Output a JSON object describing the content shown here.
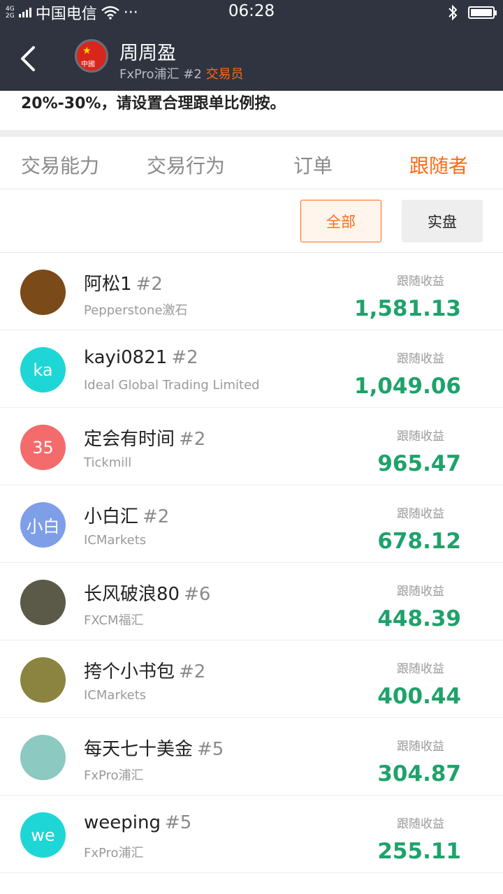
{
  "status_bar": {
    "network_top": "4G",
    "network_bottom": "2G",
    "carrier": "中国电信",
    "wifi_icon": "wifi-icon",
    "more": "···",
    "time": "06:28",
    "bluetooth_icon": "bluetooth-icon",
    "battery_icon": "battery-icon"
  },
  "header": {
    "back_icon": "back-arrow-icon",
    "flag_label": "中國",
    "trader_name": "周周盈",
    "broker_rank": "FxPro浦汇 #2",
    "role": "交易员"
  },
  "notice": "20%-30%，请设置合理跟单比例按。",
  "tabs": [
    "交易能力",
    "交易行为",
    "订单",
    "跟随者"
  ],
  "active_tab": "跟随者",
  "filters": {
    "all": "全部",
    "real": "实盘"
  },
  "profit_label": "跟随收益",
  "colors": {
    "accent": "#ff6a13",
    "profit": "#1ea26b",
    "header_bg": "#2f3440"
  },
  "followers": [
    {
      "name": "阿松1",
      "rank": "#2",
      "broker": "Pepperstone激石",
      "profit": "1,581.13",
      "avatar_text": "",
      "avatar_color": "#7a4a18"
    },
    {
      "name": "kayi0821",
      "rank": "#2",
      "broker": "Ideal Global Trading Limited",
      "profit": "1,049.06",
      "avatar_text": "ka",
      "avatar_color": "#1fd6d6"
    },
    {
      "name": "定会有时间",
      "rank": "#2",
      "broker": "Tickmill",
      "profit": "965.47",
      "avatar_text": "35",
      "avatar_color": "#f36b6b"
    },
    {
      "name": "小白汇",
      "rank": "#2",
      "broker": "ICMarkets",
      "profit": "678.12",
      "avatar_text": "小白",
      "avatar_color": "#7f9ee8"
    },
    {
      "name": "长风破浪80",
      "rank": "#6",
      "broker": "FXCM福汇",
      "profit": "448.39",
      "avatar_text": "",
      "avatar_color": "#5b5a48"
    },
    {
      "name": "挎个小书包",
      "rank": "#2",
      "broker": "ICMarkets",
      "profit": "400.44",
      "avatar_text": "",
      "avatar_color": "#8a8440"
    },
    {
      "name": "每天七十美金",
      "rank": "#5",
      "broker": "FxPro浦汇",
      "profit": "304.87",
      "avatar_text": "",
      "avatar_color": "#8cc9c0"
    },
    {
      "name": "weeping",
      "rank": "#5",
      "broker": "FxPro浦汇",
      "profit": "255.11",
      "avatar_text": "we",
      "avatar_color": "#1fd6d6"
    }
  ]
}
